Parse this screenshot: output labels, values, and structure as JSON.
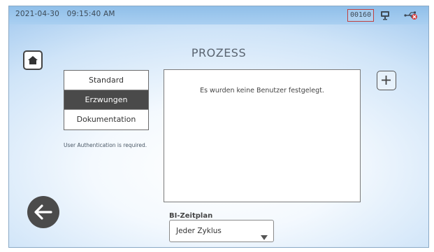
{
  "status_bar": {
    "date": "2021-04-30",
    "time": "09:15:40 AM",
    "counter": "00160",
    "icons": [
      "monitor-icon",
      "usb-error-icon"
    ]
  },
  "header": {
    "title": "PROZESS"
  },
  "navigation": {
    "home_icon": "home-icon",
    "back_icon": "arrow-left-icon"
  },
  "modes": {
    "items": [
      {
        "label": "Standard",
        "selected": false
      },
      {
        "label": "Erzwungen",
        "selected": true
      },
      {
        "label": "Dokumentation",
        "selected": false
      }
    ],
    "note": "User Authentication is required."
  },
  "users": {
    "empty_message": "Es wurden keine Benutzer festgelegt.",
    "add_icon": "plus-icon"
  },
  "bi_schedule": {
    "label": "BI-Zeitplan",
    "selected": "Jeder Zyklus"
  },
  "colors": {
    "topbar": "#9cc7ee",
    "active_item": "#4a4a4a",
    "back_button": "#4b4b4b",
    "counter_border": "#c04040"
  }
}
